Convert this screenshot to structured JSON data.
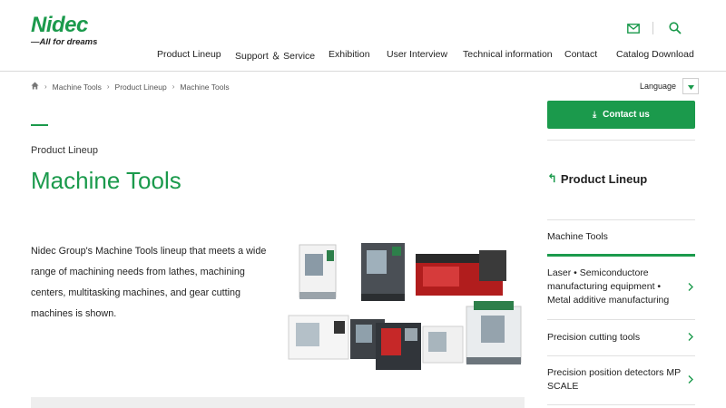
{
  "header": {
    "logo_word": "Nidec",
    "logo_tagline": "—All for dreams",
    "nav": [
      "Product Lineup",
      "Support ＆ Service",
      "Exhibition",
      "User Interview",
      "Technical information",
      "Contact",
      "Catalog Download"
    ],
    "icons": [
      "mail-icon",
      "search-icon"
    ]
  },
  "breadcrumb": {
    "items": [
      "Machine Tools",
      "Product Lineup",
      "Machine Tools"
    ]
  },
  "language": {
    "label": "Language"
  },
  "main": {
    "kicker": "Product Lineup",
    "title": "Machine Tools",
    "intro": "Nidec Group's Machine Tools lineup that meets a wide range of machining needs from lathes, machining centers, multitasking machines, and gear cutting machines is shown."
  },
  "sidebar": {
    "contact_label": "Contact us",
    "title": "Product Lineup",
    "active_item": "Machine Tools",
    "items": [
      {
        "label": "Laser • Semiconductore manufacturing equipment • Metal additive manufacturing"
      },
      {
        "label": "Precision cutting tools"
      },
      {
        "label": "Precision position detectors MP SCALE"
      }
    ]
  },
  "colors": {
    "brand": "#1b9a4c",
    "text": "#222222",
    "strip": "#eeeeee"
  }
}
